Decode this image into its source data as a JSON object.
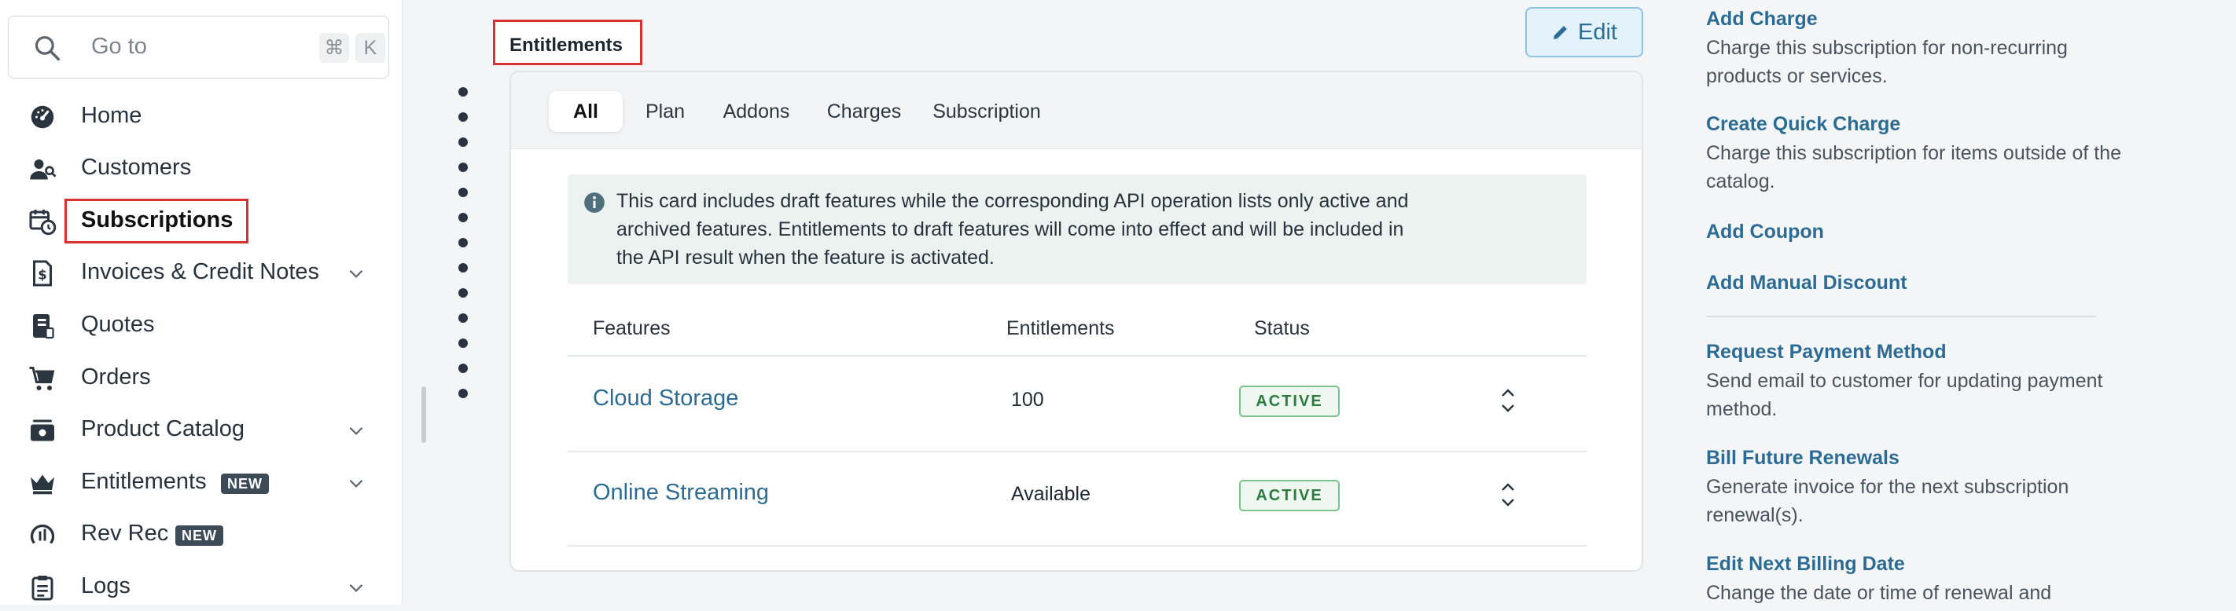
{
  "search": {
    "placeholder": "Go to",
    "shortcut_cmd": "⌘",
    "shortcut_key": "K"
  },
  "sidebar": {
    "items": [
      {
        "label": "Home",
        "icon": "dashboard-icon"
      },
      {
        "label": "Customers",
        "icon": "customers-icon"
      },
      {
        "label": "Subscriptions",
        "icon": "calendar-clock-icon",
        "active": true
      },
      {
        "label": "Invoices & Credit Notes",
        "icon": "invoice-icon",
        "expandable": true
      },
      {
        "label": "Quotes",
        "icon": "quote-icon"
      },
      {
        "label": "Orders",
        "icon": "cart-icon"
      },
      {
        "label": "Product Catalog",
        "icon": "catalog-icon",
        "expandable": true
      },
      {
        "label": "Entitlements",
        "icon": "crown-icon",
        "badge": "NEW",
        "expandable": true
      },
      {
        "label": "Rev Rec",
        "icon": "rev-rec-icon",
        "badge": "NEW"
      },
      {
        "label": "Logs",
        "icon": "clipboard-icon",
        "expandable": true
      }
    ]
  },
  "main": {
    "section_title": "Entitlements",
    "edit_label": "Edit",
    "tabs": [
      "All",
      "Plan",
      "Addons",
      "Charges",
      "Subscription"
    ],
    "active_tab": "All",
    "info_text": "This card includes draft features while the corresponding API operation lists only active and archived features. Entitlements to draft features will come into effect and will be included in the API result when the feature is activated.",
    "table": {
      "headers": [
        "Features",
        "Entitlements",
        "Status"
      ],
      "rows": [
        {
          "feature": "Cloud Storage",
          "entitlement": "100",
          "status": "ACTIVE"
        },
        {
          "feature": "Online Streaming",
          "entitlement": "Available",
          "status": "ACTIVE"
        }
      ]
    }
  },
  "actions": [
    {
      "title": "Add Charge",
      "desc": "Charge this subscription for non-recurring products or services."
    },
    {
      "title": "Create Quick Charge",
      "desc": "Charge this subscription for items outside of the catalog."
    },
    {
      "title": "Add Coupon"
    },
    {
      "title": "Add Manual Discount"
    },
    {
      "title": "Request Payment Method",
      "desc": "Send email to customer for updating payment method."
    },
    {
      "title": "Bill Future Renewals",
      "desc": "Generate invoice for the next subscription renewal(s)."
    },
    {
      "title": "Edit Next Billing Date",
      "desc": "Change the date or time of renewal and"
    }
  ],
  "colors": {
    "accent_link": "#2c6c94",
    "highlight_border": "#d9322e",
    "status_green": "#2c7a3f"
  }
}
